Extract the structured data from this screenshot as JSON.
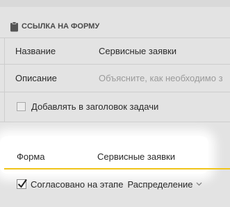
{
  "section": {
    "title": "ССЫЛКА НА ФОРМУ",
    "icon": "clipboard-icon"
  },
  "fields": {
    "name_label": "Название",
    "name_value": "Сервисные заявки",
    "description_label": "Описание",
    "description_placeholder": "Объясните, как необходимо з"
  },
  "add_to_title": {
    "label": "Добавлять в заголовок задачи",
    "checked": false
  },
  "form_field": {
    "label": "Форма",
    "value": "Сервисные заявки"
  },
  "agreed": {
    "label": "Согласовано на этапе",
    "checked": true,
    "stage": "Распределение"
  },
  "colors": {
    "accent": "#f0c419",
    "background": "#e3e3e3",
    "highlight": "#ffffff"
  }
}
